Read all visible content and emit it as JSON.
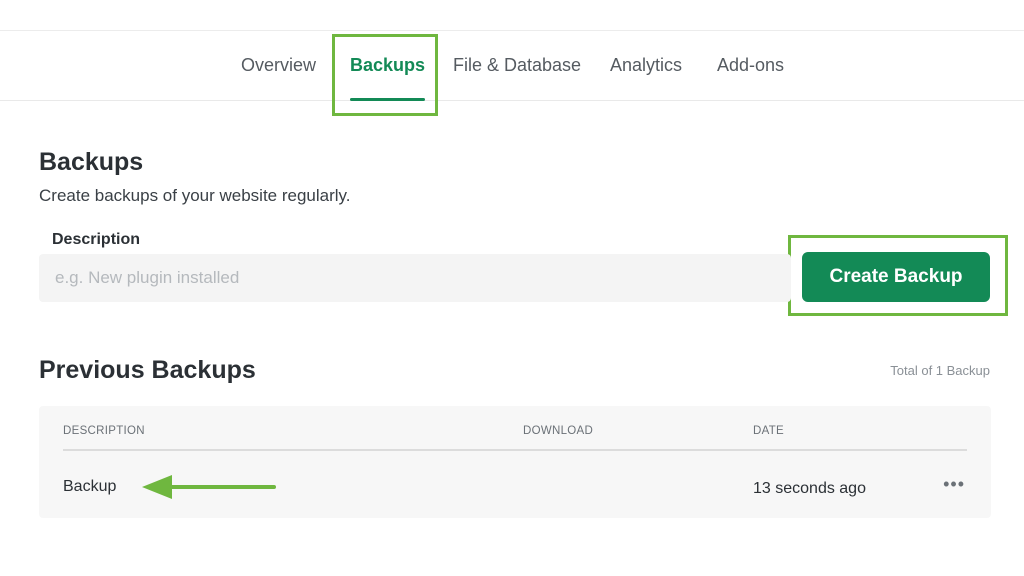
{
  "tabs": [
    {
      "label": "Overview",
      "active": false
    },
    {
      "label": "Backups",
      "active": true
    },
    {
      "label": "File & Database",
      "active": false
    },
    {
      "label": "Analytics",
      "active": false
    },
    {
      "label": "Add-ons",
      "active": false
    }
  ],
  "backups_section": {
    "title": "Backups",
    "subtitle": "Create backups of your website regularly.",
    "description_label": "Description",
    "description_placeholder": "e.g. New plugin installed",
    "description_value": "",
    "create_button_label": "Create Backup"
  },
  "previous_backups": {
    "title": "Previous Backups",
    "total_text": "Total of 1 Backup",
    "columns": [
      "DESCRIPTION",
      "DOWNLOAD",
      "DATE"
    ],
    "rows": [
      {
        "description": "Backup",
        "download": "",
        "date": "13 seconds ago",
        "menu": "•••"
      }
    ]
  },
  "colors": {
    "accent": "#138a56",
    "highlight": "#6fb73f"
  },
  "annotations": {
    "arrow_icon": "left-arrow-icon"
  }
}
